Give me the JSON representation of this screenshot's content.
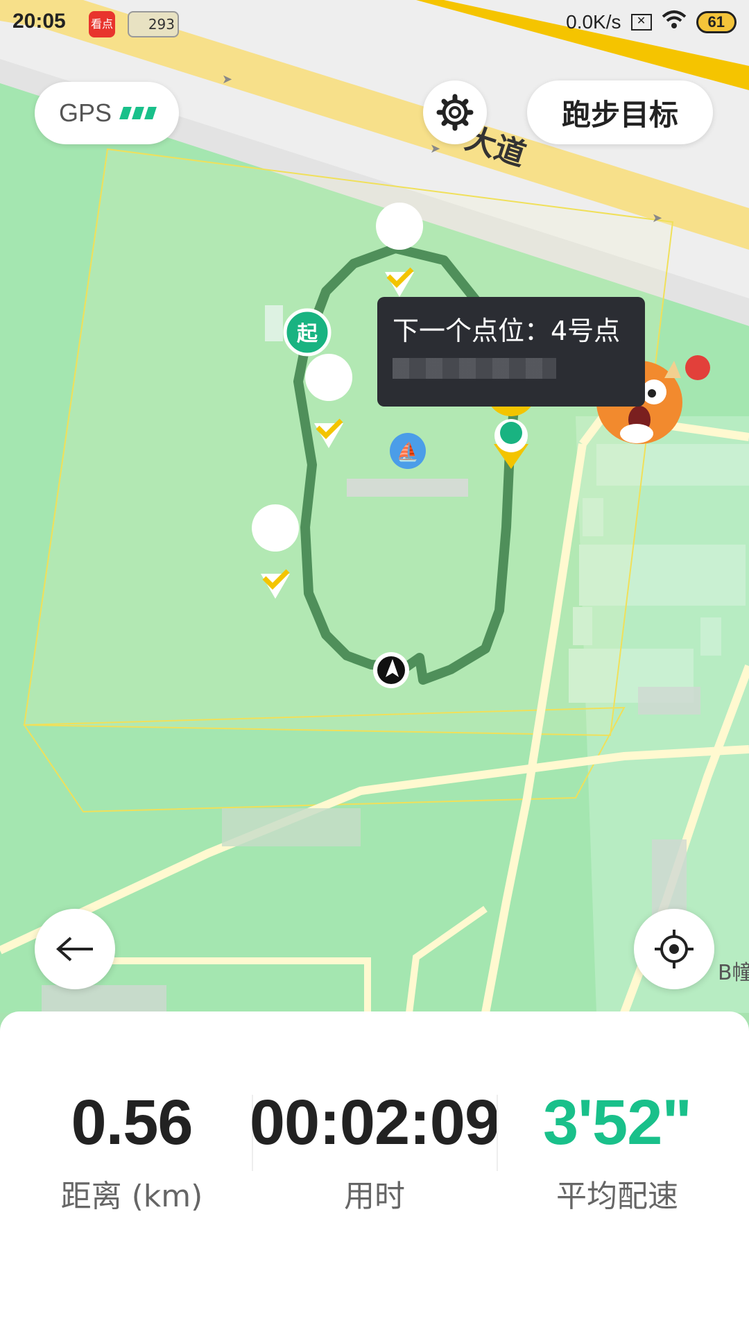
{
  "status_bar": {
    "time": "20:05",
    "app_badge_1": "看点",
    "app_badge_2": "293",
    "net_speed": "0.0K/s",
    "battery": "61"
  },
  "map": {
    "road_label": "大道",
    "building_label": "B幢",
    "start_marker": "起",
    "checkpoint_count_done": 3
  },
  "gps": {
    "label": "GPS"
  },
  "toolbar": {
    "goal_label": "跑步目标"
  },
  "tooltip": {
    "next_point": "下一个点位：4号点"
  },
  "stats": {
    "distance_value": "0.56",
    "distance_label": "距离 (km)",
    "time_value": "00:02:09",
    "time_label": "用时",
    "pace_value": "3'52\"",
    "pace_label": "平均配速"
  },
  "colors": {
    "accent": "#19c08a",
    "route": "#4f8f5a",
    "marker_yellow": "#f3c400",
    "tooltip_bg": "#2b2d33"
  }
}
